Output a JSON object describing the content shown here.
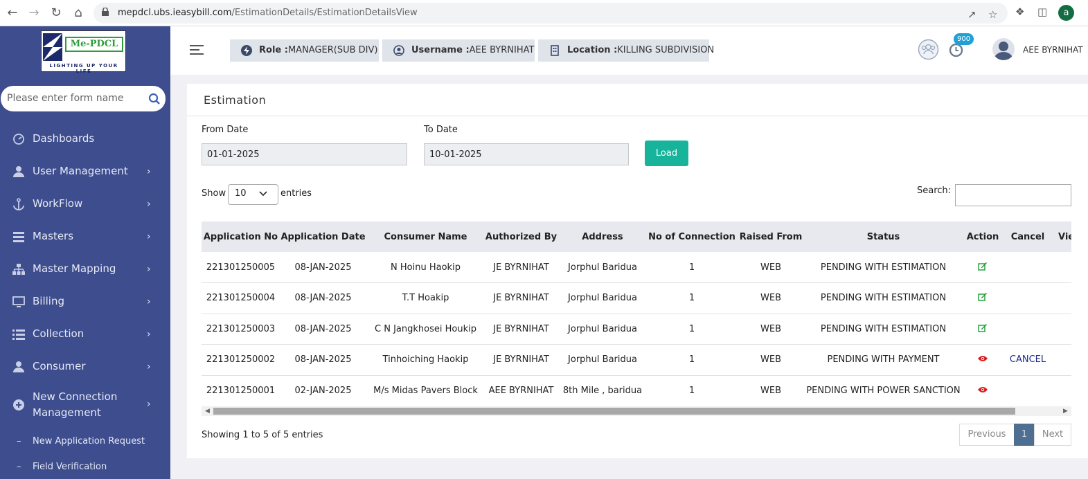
{
  "browser": {
    "url_host": "mepdcl.ubs.ieasybill.com",
    "url_path": "/EstimationDetails/EstimationDetailsView",
    "profile_initial": "a"
  },
  "sidebar": {
    "logo": {
      "name": "Me-PDCL",
      "tagline": "LIGHTING UP YOUR LIFE"
    },
    "search_placeholder": "Please enter form name",
    "menu": [
      {
        "label": "Dashboards",
        "icon": "dashboard-icon",
        "has_arrow": false
      },
      {
        "label": "User Management",
        "icon": "user-icon",
        "has_arrow": true
      },
      {
        "label": "WorkFlow",
        "icon": "anchor-icon",
        "has_arrow": true
      },
      {
        "label": "Masters",
        "icon": "list-icon",
        "has_arrow": true
      },
      {
        "label": "Master Mapping",
        "icon": "sitemap-icon",
        "has_arrow": true
      },
      {
        "label": "Billing",
        "icon": "desktop-icon",
        "has_arrow": true
      },
      {
        "label": "Collection",
        "icon": "list-icon",
        "has_arrow": true
      },
      {
        "label": "Consumer",
        "icon": "user-icon",
        "has_arrow": true
      },
      {
        "label": "New Connection",
        "label2": "Management",
        "icon": "plus-circle-icon",
        "has_arrow": true
      }
    ],
    "submenu": [
      {
        "label": "New Application Request"
      },
      {
        "label": "Field Verification"
      }
    ]
  },
  "header": {
    "role_label": "Role :",
    "role_value": "MANAGER(SUB DIV)",
    "username_label": "Username :",
    "username_value": "AEE BYRNIHAT",
    "location_label": "Location :",
    "location_value": "KILLING SUBDIVISION",
    "notification_count": "900",
    "user_display": "AEE BYRNIHAT"
  },
  "estimation": {
    "title": "Estimation",
    "from_date_label": "From Date",
    "from_date_value": "01-01-2025",
    "to_date_label": "To Date",
    "to_date_value": "10-01-2025",
    "load_label": "Load",
    "show_label": "Show",
    "entries_value": "10",
    "entries_label": "entries",
    "search_label": "Search:",
    "search_value": "",
    "columns": [
      "Application No",
      "Application Date",
      "Consumer Name",
      "Authorized By",
      "Address",
      "No of Connection",
      "Raised From",
      "Status",
      "Action",
      "Cancel",
      "View"
    ],
    "rows": [
      {
        "app_no": "221301250005",
        "date": "08-JAN-2025",
        "consumer": "N Hoinu Haokip",
        "authorized": "JE BYRNIHAT",
        "address": "Jorphul Baridua",
        "connections": "1",
        "raised": "WEB",
        "status": "PENDING WITH ESTIMATION",
        "action": "edit-icon",
        "cancel": ""
      },
      {
        "app_no": "221301250004",
        "date": "08-JAN-2025",
        "consumer": "T.T Hoakip",
        "authorized": "JE BYRNIHAT",
        "address": "Jorphul Baridua",
        "connections": "1",
        "raised": "WEB",
        "status": "PENDING WITH ESTIMATION",
        "action": "edit-icon",
        "cancel": ""
      },
      {
        "app_no": "221301250003",
        "date": "08-JAN-2025",
        "consumer": "C N Jangkhosei Houkip",
        "authorized": "JE BYRNIHAT",
        "address": "Jorphul Baridua",
        "connections": "1",
        "raised": "WEB",
        "status": "PENDING WITH ESTIMATION",
        "action": "edit-icon",
        "cancel": ""
      },
      {
        "app_no": "221301250002",
        "date": "08-JAN-2025",
        "consumer": "Tinhoiching Haokip",
        "authorized": "JE BYRNIHAT",
        "address": "Jorphul Baridua",
        "connections": "1",
        "raised": "WEB",
        "status": "PENDING WITH PAYMENT",
        "action": "eye-icon",
        "cancel": "CANCEL"
      },
      {
        "app_no": "221301250001",
        "date": "02-JAN-2025",
        "consumer": "M/s Midas Pavers Block",
        "authorized": "AEE BYRNIHAT",
        "address": "8th Mile , baridua",
        "connections": "1",
        "raised": "WEB",
        "status": "PENDING WITH POWER SANCTION",
        "action": "eye-icon",
        "cancel": ""
      }
    ],
    "info_text": "Showing 1 to 5 of 5 entries",
    "pagination": {
      "previous": "Previous",
      "current": "1",
      "next": "Next"
    }
  },
  "colors": {
    "sidebar_bg": "#3d4d8e",
    "load_button": "#17b39a",
    "edit_icon": "#1a9b33",
    "eye_icon": "#d81e1e",
    "pager_active": "#4e6f91"
  }
}
